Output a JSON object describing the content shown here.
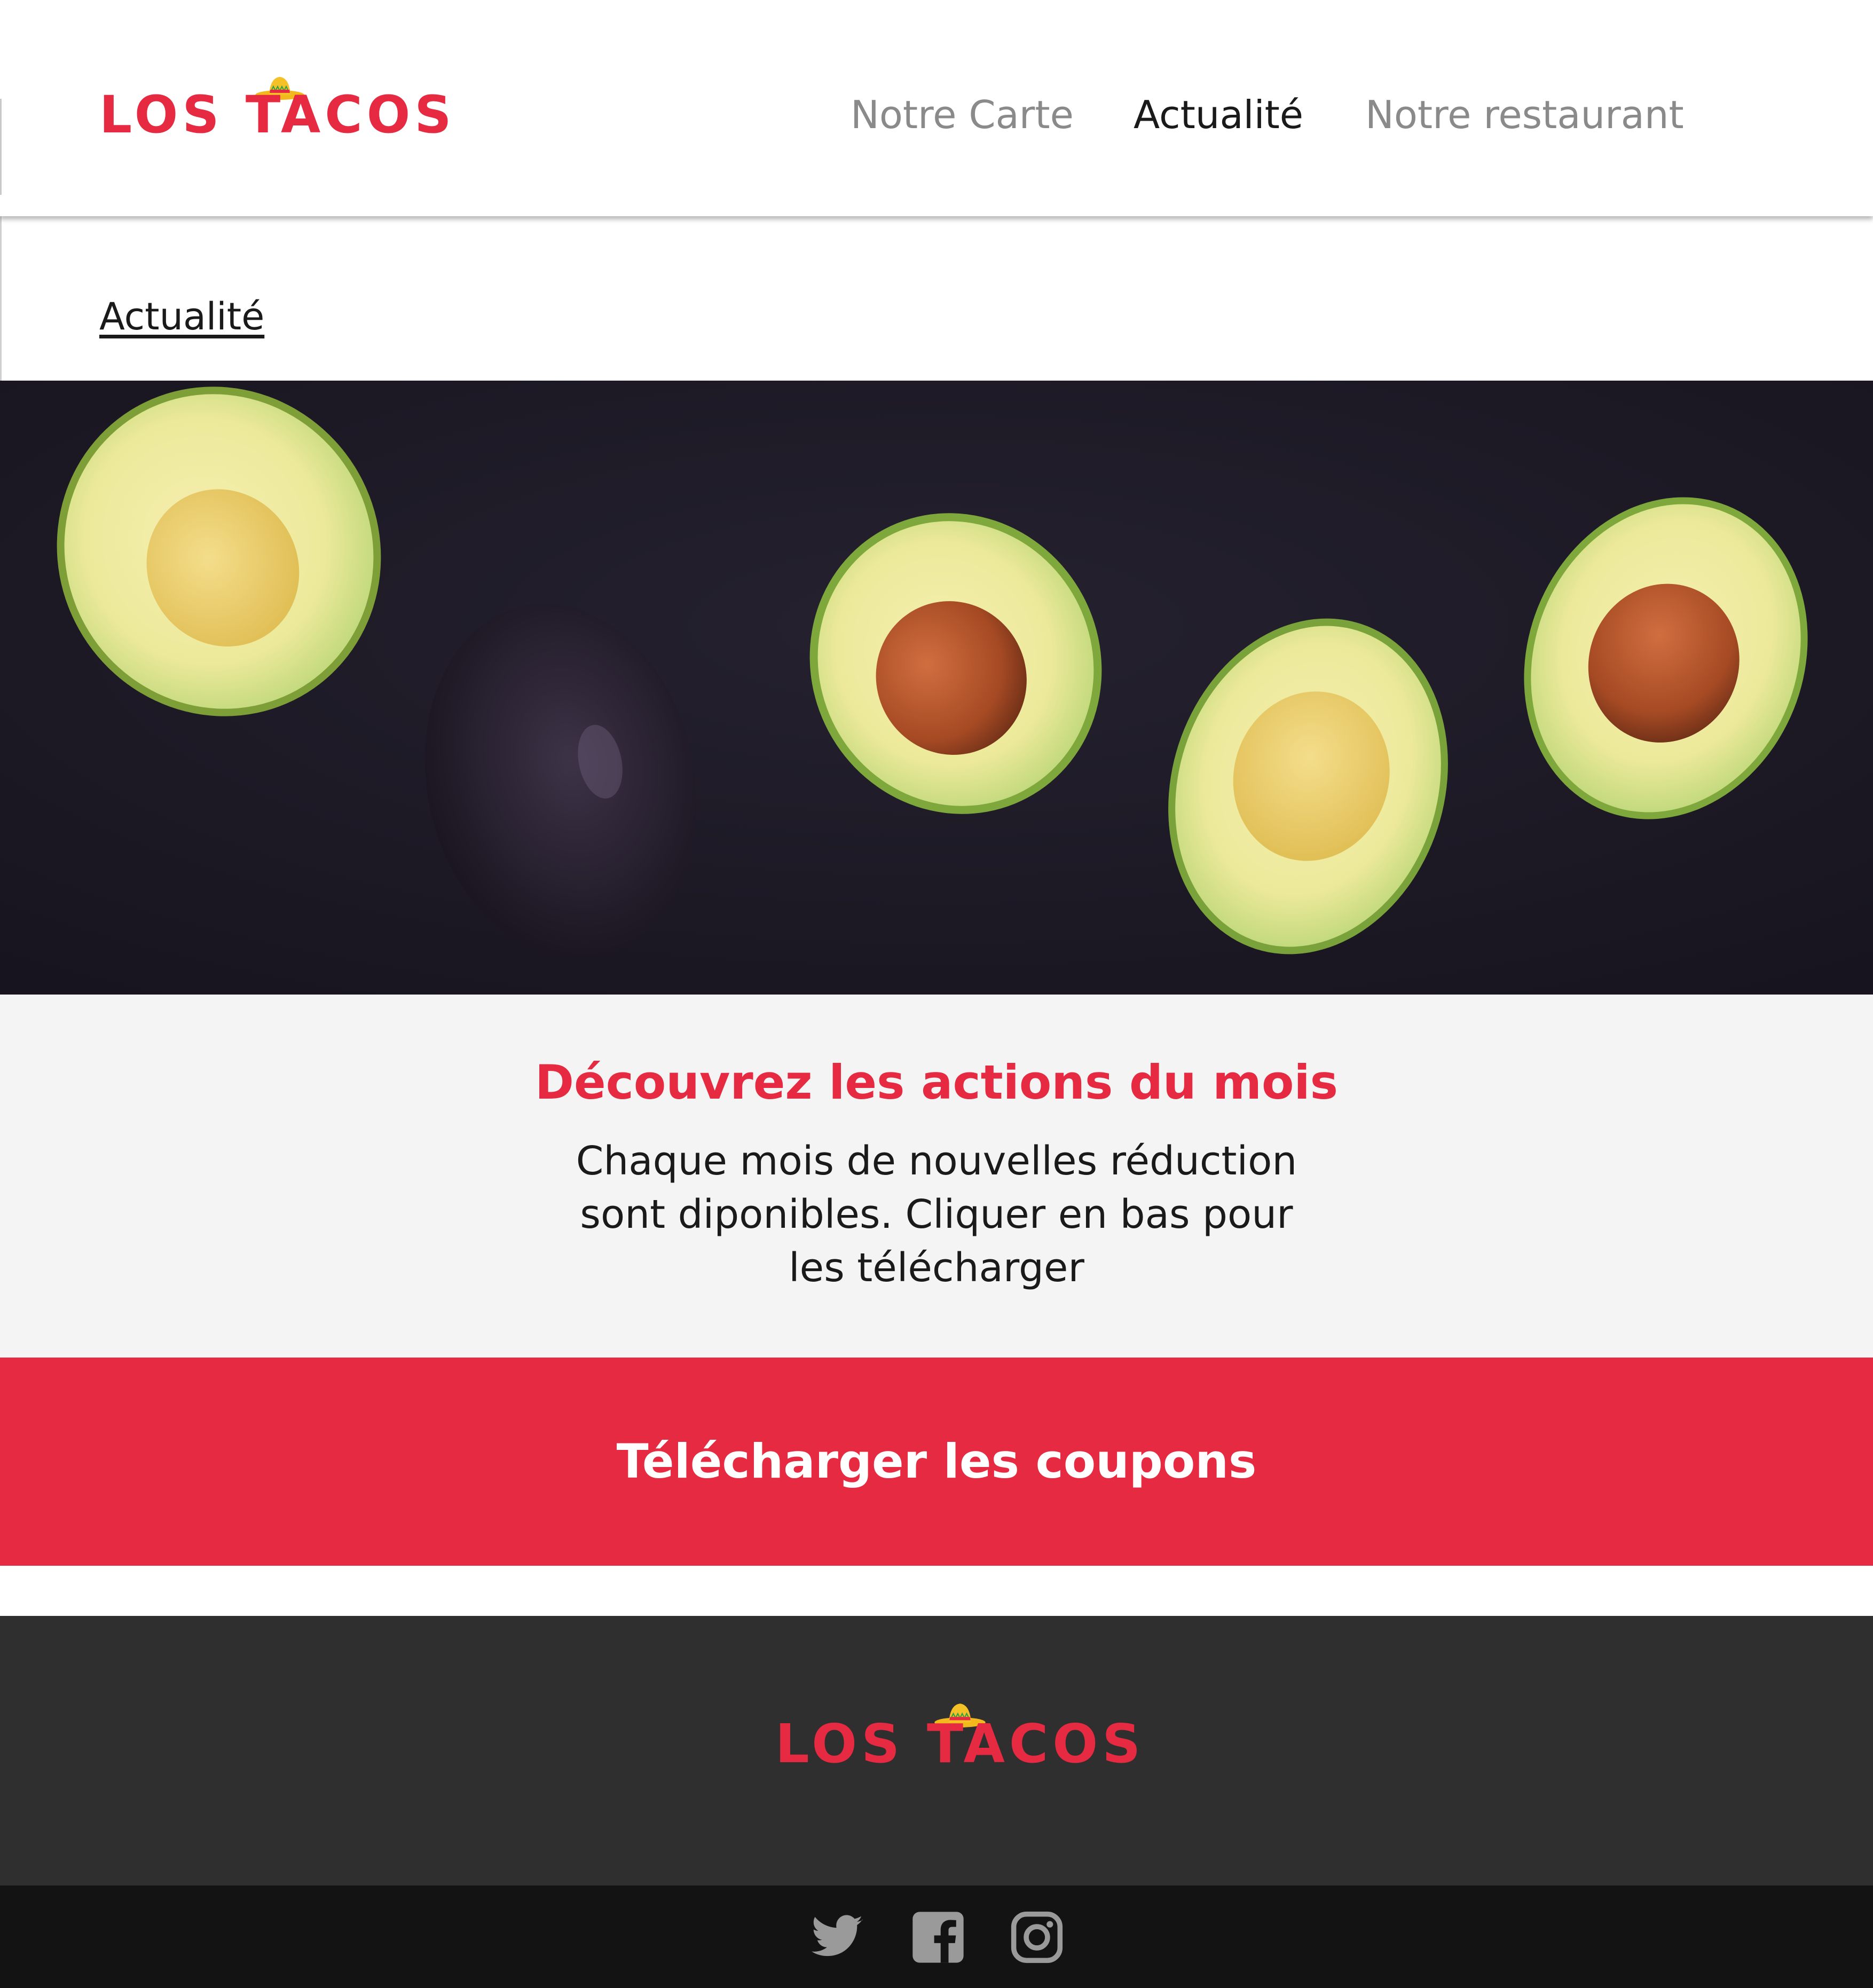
{
  "brand": {
    "name": "LOS TACOS",
    "accent_color": "#e52a41",
    "logo_icon": "sombrero-icon"
  },
  "nav": {
    "items": [
      {
        "label": "Notre Carte",
        "active": false
      },
      {
        "label": "Actualité",
        "active": true
      },
      {
        "label": "Notre restaurant",
        "active": false
      }
    ]
  },
  "breadcrumb": {
    "label": "Actualité"
  },
  "hero": {
    "image": "avocados-on-dark-background"
  },
  "promo": {
    "title": "Découvrez les actions du mois",
    "text": "Chaque mois de nouvelles réduction sont diponibles. Cliquer en bas pour les télécharger"
  },
  "cta": {
    "label": "Télécharger les coupons"
  },
  "footer": {
    "logo_text": "LOS TACOS",
    "background_color": "#2f2f30"
  },
  "social": {
    "icons": [
      "twitter-icon",
      "facebook-icon",
      "instagram-icon"
    ],
    "icon_color": "#9a9a9a"
  }
}
